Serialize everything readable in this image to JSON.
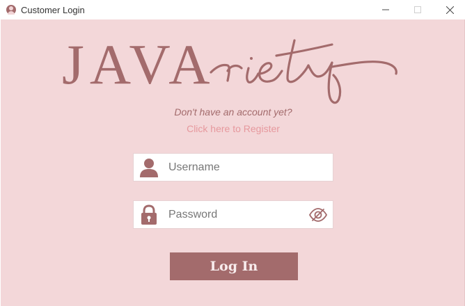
{
  "window": {
    "title": "Customer Login",
    "icon": "user-avatar-icon"
  },
  "logo": {
    "part1": "JAVA",
    "part2": "riety",
    "color": "#a36b6c"
  },
  "register": {
    "prompt": "Don't have an account yet?",
    "link_label": "Click here to Register"
  },
  "username_field": {
    "placeholder": "Username",
    "value": "",
    "icon": "user-icon"
  },
  "password_field": {
    "placeholder": "Password",
    "value": "",
    "icon": "lock-icon",
    "toggle_icon": "eye-slash-icon"
  },
  "login_button": {
    "label": "Log In"
  },
  "colors": {
    "background": "#f3d7d9",
    "accent": "#a36b6c",
    "link": "#e6989d"
  }
}
